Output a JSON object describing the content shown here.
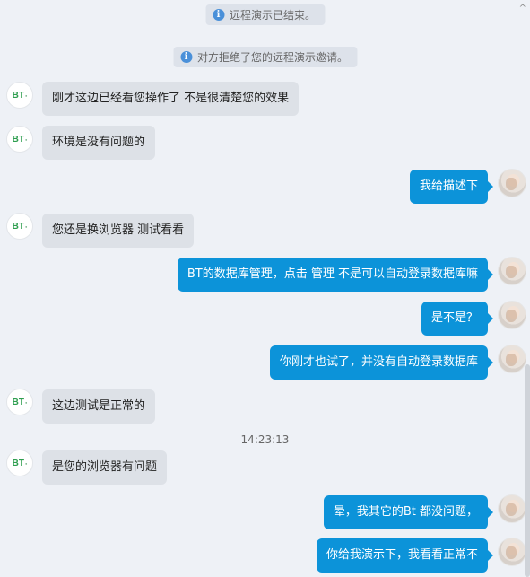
{
  "notices": [
    {
      "text": "远程演示已结束。",
      "icon": "info-icon"
    },
    {
      "text": "对方拒绝了您的远程演示邀请。",
      "icon": "info-icon"
    }
  ],
  "contact_avatar_label": "BT",
  "messages": [
    {
      "side": "in",
      "text": "刚才这边已经看您操作了  不是很清楚您的效果"
    },
    {
      "side": "in",
      "text": "环境是没有问题的"
    },
    {
      "side": "out",
      "text": "我给描述下"
    },
    {
      "side": "in",
      "text": "您还是换浏览器  测试看看"
    },
    {
      "side": "out",
      "text": "BT的数据库管理，点击  管理  不是可以自动登录数据库嘛"
    },
    {
      "side": "out",
      "text": "是不是？"
    },
    {
      "side": "out",
      "text": "你刚才也试了，并没有自动登录数据库"
    },
    {
      "side": "in",
      "text": "这边测试是正常的"
    },
    {
      "side": "in",
      "text": "是您的浏览器有问题"
    },
    {
      "side": "out",
      "text": "晕，我其它的Bt 都没问题，"
    },
    {
      "side": "out",
      "text": "你给我演示下，我看看正常不"
    }
  ],
  "timestamp": "14:23:13"
}
